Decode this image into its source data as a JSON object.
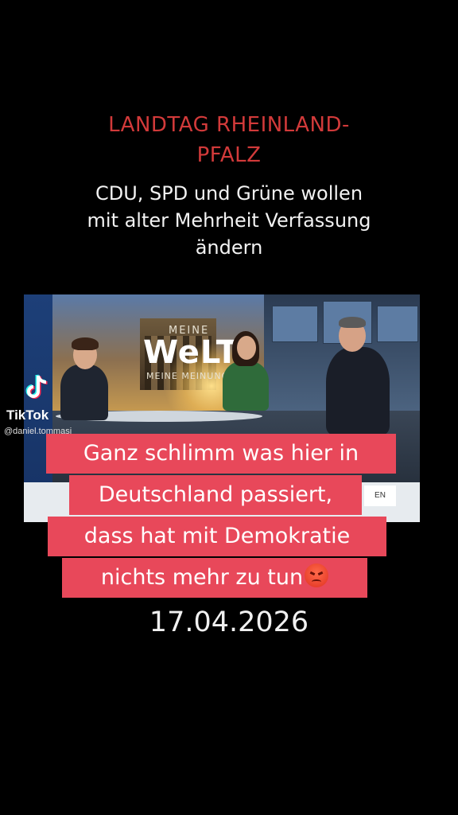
{
  "headline": {
    "red_line1": "LANDTAG RHEINLAND-",
    "red_line2": "PFALZ",
    "white_line1": "CDU, SPD und Grüne wollen",
    "white_line2": "mit alter Mehrheit Verfassung",
    "white_line3": "ändern"
  },
  "video": {
    "logo_top": "MEINE",
    "logo_main": "WeLT",
    "logo_sub": "MEINE MEINUNG",
    "ticker_tag": "EN"
  },
  "watermark": {
    "brand": "TikTok",
    "handle": "@daniel.tommasi"
  },
  "caption": {
    "line1": "Ganz schlimm was hier in",
    "line2": "Deutschland passiert,",
    "line3": "dass hat mit Demokratie",
    "line4": "nichts mehr zu tun",
    "emoji": "angry-face-icon"
  },
  "date": "17.04.2026",
  "colors": {
    "background": "#000000",
    "headline_red": "#d23a3a",
    "caption_bg": "#e8485a"
  }
}
